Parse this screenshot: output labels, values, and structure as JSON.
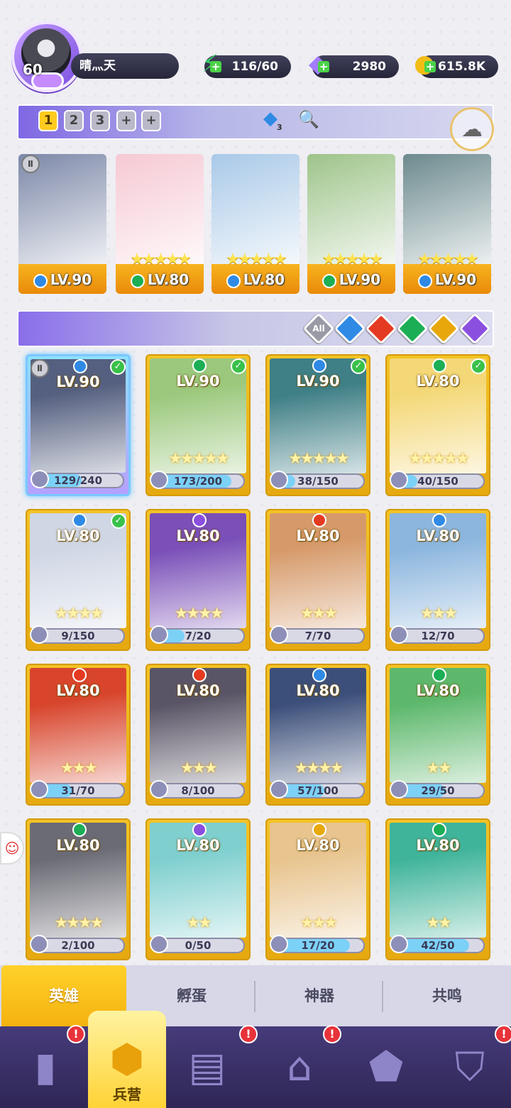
{
  "player": {
    "level": "60",
    "name": "晴灬天"
  },
  "resources": {
    "energy": "116/60",
    "gems": "2980",
    "gold": "615.8K"
  },
  "team_tabs": [
    "1",
    "2",
    "3",
    "+",
    "+"
  ],
  "team_water_count": "3",
  "team_heroes": [
    {
      "lv": "LV.90",
      "element": "water",
      "stars": "",
      "art": "#7c88a8"
    },
    {
      "lv": "LV.80",
      "element": "wind",
      "stars": "★★★★★",
      "art": "#f6c9d4"
    },
    {
      "lv": "LV.80",
      "element": "water",
      "stars": "★★★★★",
      "art": "#a9c9e8"
    },
    {
      "lv": "LV.90",
      "element": "wind",
      "stars": "★★★★★",
      "art": "#9ec48a"
    },
    {
      "lv": "LV.90",
      "element": "water",
      "stars": "★★★★★",
      "art": "#6c8a8e"
    }
  ],
  "filters": {
    "all_label": "All",
    "elements": [
      "water",
      "fire",
      "wind",
      "light",
      "moon"
    ]
  },
  "heroes": [
    {
      "lv": "LV.90",
      "element": "water",
      "checked": true,
      "stars": "",
      "progress": "129/240",
      "ratio": 0.54,
      "art": "#556080",
      "selected": true
    },
    {
      "lv": "LV.90",
      "element": "wind",
      "checked": true,
      "stars": "★★★★★",
      "progress": "173/200",
      "ratio": 0.87,
      "art": "#9bc87c"
    },
    {
      "lv": "LV.90",
      "element": "water",
      "checked": true,
      "stars": "★★★★★",
      "progress": "38/150",
      "ratio": 0.25,
      "art": "#3f7f86"
    },
    {
      "lv": "LV.80",
      "element": "wind",
      "checked": true,
      "stars": "★★★★★",
      "progress": "40/150",
      "ratio": 0.27,
      "art": "#f4d878"
    },
    {
      "lv": "LV.80",
      "element": "water",
      "checked": true,
      "stars": "★★★★",
      "progress": "9/150",
      "ratio": 0.06,
      "art": "#cfd6e4"
    },
    {
      "lv": "LV.80",
      "element": "moon",
      "checked": false,
      "stars": "★★★★",
      "progress": "7/20",
      "ratio": 0.35,
      "art": "#7a4fb8"
    },
    {
      "lv": "LV.80",
      "element": "fire",
      "checked": false,
      "stars": "★★★",
      "progress": "7/70",
      "ratio": 0.1,
      "art": "#d69a6a"
    },
    {
      "lv": "LV.80",
      "element": "water",
      "checked": false,
      "stars": "★★★",
      "progress": "12/70",
      "ratio": 0.17,
      "art": "#8cb6de"
    },
    {
      "lv": "LV.80",
      "element": "fire",
      "checked": false,
      "stars": "★★★",
      "progress": "31/70",
      "ratio": 0.44,
      "art": "#d8452c"
    },
    {
      "lv": "LV.80",
      "element": "fire",
      "checked": false,
      "stars": "★★★",
      "progress": "8/100",
      "ratio": 0.08,
      "art": "#5a5566"
    },
    {
      "lv": "LV.80",
      "element": "water",
      "checked": false,
      "stars": "★★★★",
      "progress": "57/100",
      "ratio": 0.57,
      "art": "#3c4f7a"
    },
    {
      "lv": "LV.80",
      "element": "wind",
      "checked": false,
      "stars": "★★",
      "progress": "29/50",
      "ratio": 0.58,
      "art": "#5db86c"
    },
    {
      "lv": "LV.80",
      "element": "wind",
      "checked": false,
      "stars": "★★★★",
      "progress": "2/100",
      "ratio": 0.02,
      "art": "#6b6b75"
    },
    {
      "lv": "LV.80",
      "element": "moon",
      "checked": false,
      "stars": "★★",
      "progress": "0/50",
      "ratio": 0.0,
      "art": "#7fcfcf"
    },
    {
      "lv": "LV.80",
      "element": "light",
      "checked": false,
      "stars": "★★★",
      "progress": "17/20",
      "ratio": 0.85,
      "art": "#e8c48e"
    },
    {
      "lv": "LV.80",
      "element": "wind",
      "checked": false,
      "stars": "★★",
      "progress": "42/50",
      "ratio": 0.84,
      "art": "#3fb49a"
    }
  ],
  "tabs": [
    "英雄",
    "孵蛋",
    "神器",
    "共鸣"
  ],
  "nav": {
    "active_label": "兵营",
    "alert_mark": "!"
  },
  "colors": {
    "accent": "#ffcb1f",
    "nav_bg": "#2f2655",
    "alert": "#e8323a"
  }
}
